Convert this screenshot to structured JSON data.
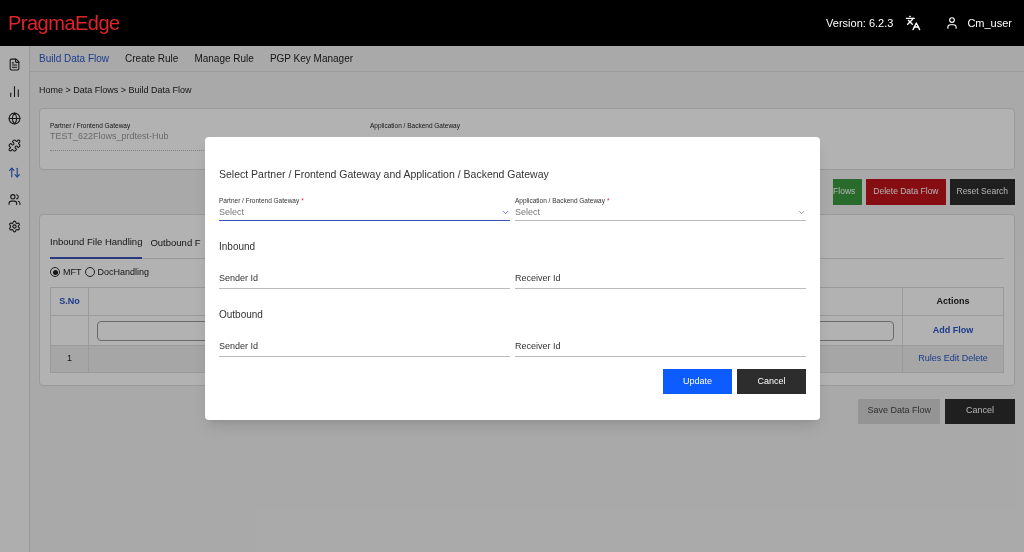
{
  "header": {
    "logo": "PragmaEdge",
    "version": "Version: 6.2.3",
    "user": "Cm_user"
  },
  "nav_tabs": [
    {
      "label": "Build Data Flow",
      "selected": true
    },
    {
      "label": "Create Rule",
      "selected": false
    },
    {
      "label": "Manage Rule",
      "selected": false
    },
    {
      "label": "PGP Key Manager",
      "selected": false
    }
  ],
  "breadcrumb": "Home > Data Flows > Build Data Flow",
  "filter_card": {
    "partner_label": "Partner / Frontend Gateway",
    "partner_value": "TEST_622Flows_prdtest-Hub",
    "application_label": "Application / Backend Gateway"
  },
  "action_buttons": [
    {
      "label": "Flows",
      "kind": "green"
    },
    {
      "label": "Delete Data Flow",
      "kind": "red"
    },
    {
      "label": "Reset Search",
      "kind": "dark"
    }
  ],
  "flow_tabs": [
    {
      "label": "Inbound File Handling",
      "selected": true
    },
    {
      "label": "Outbound F",
      "selected": false
    }
  ],
  "radios": [
    {
      "label": "MFT",
      "selected": true
    },
    {
      "label": "DocHandling",
      "selected": false
    }
  ],
  "table": {
    "columns": [
      "S.No",
      "Actions"
    ],
    "input_row_action": "Add Flow",
    "rows": [
      {
        "sno": "1",
        "actions": "Rules Edit Delete"
      }
    ]
  },
  "footer_buttons": [
    {
      "label": "Save Data Flow",
      "disabled": true
    },
    {
      "label": "Cancel",
      "disabled": false
    }
  ],
  "dialog": {
    "title": "Select Partner / Frontend Gateway and Application / Backend Gateway",
    "selects": [
      {
        "label": "Partner / Frontend Gateway",
        "required_mark": "*",
        "placeholder": "Select",
        "focused": true
      },
      {
        "label": "Application / Backend Gateway",
        "required_mark": "*",
        "placeholder": "Select",
        "focused": false
      }
    ],
    "sections": [
      {
        "title": "Inbound",
        "fields": [
          "Sender Id",
          "Receiver Id"
        ]
      },
      {
        "title": "Outbound",
        "fields": [
          "Sender Id",
          "Receiver Id"
        ]
      }
    ],
    "buttons": [
      {
        "label": "Update",
        "kind": "primary"
      },
      {
        "label": "Cancel",
        "kind": "dark"
      }
    ]
  }
}
